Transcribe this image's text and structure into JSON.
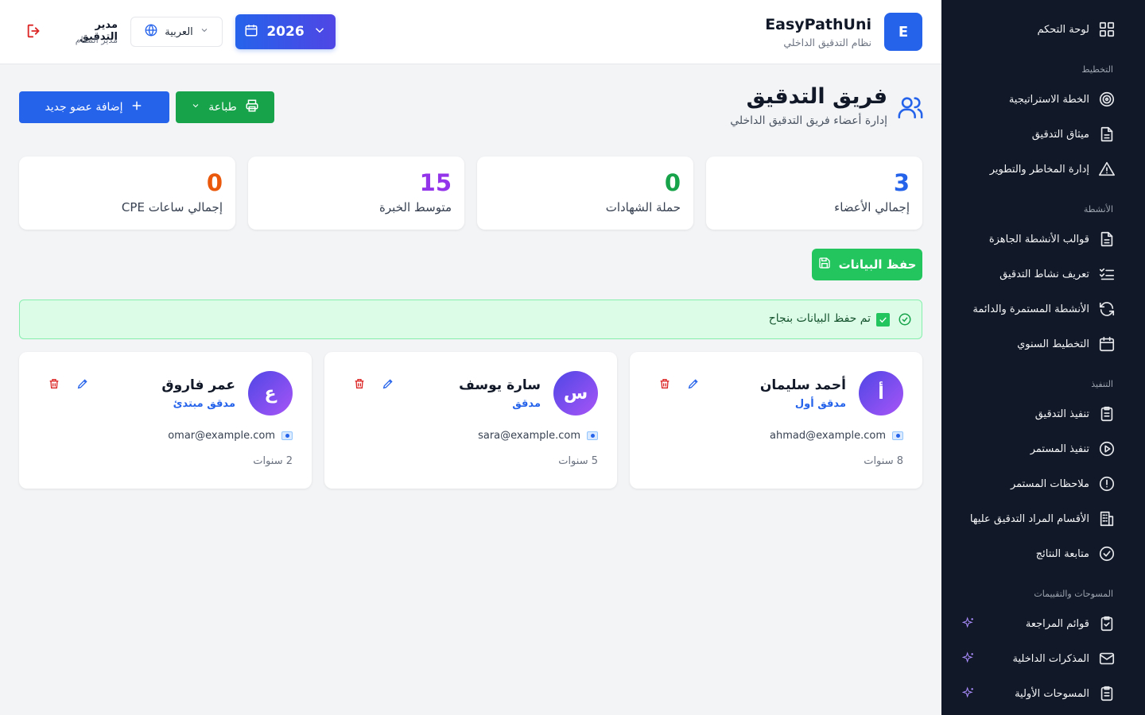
{
  "header": {
    "brand_logo": "E",
    "brand_name": "EasyPathUni",
    "brand_sub": "نظام التدقيق الداخلي",
    "year": "2026",
    "language": "العربية",
    "user_name": "مدير التدقيق",
    "user_role": "مدير النظام"
  },
  "sidebar": {
    "dashboard": "لوحة التحكم",
    "sections": {
      "planning": "التخطيط",
      "activities": "الأنشطة",
      "execution": "التنفيذ",
      "surveys": "المسوحات والتقييمات"
    },
    "items": [
      {
        "label": "الخطة الاستراتيجية",
        "icon": "target-icon"
      },
      {
        "label": "ميثاق التدقيق",
        "icon": "document-icon"
      },
      {
        "label": "إدارة المخاطر والتطوير",
        "icon": "warning-icon"
      },
      {
        "label": "قوالب الأنشطة الجاهزة",
        "icon": "document-icon"
      },
      {
        "label": "تعريف نشاط التدقيق",
        "icon": "checklist-icon"
      },
      {
        "label": "الأنشطة المستمرة والدائمة",
        "icon": "refresh-icon"
      },
      {
        "label": "التخطيط السنوي",
        "icon": "calendar-icon"
      },
      {
        "label": "تنفيذ التدقيق",
        "icon": "clipboard-list-icon"
      },
      {
        "label": "تنفيذ المستمر",
        "icon": "play-circle-icon"
      },
      {
        "label": "ملاحظات المستمر",
        "icon": "alert-circle-icon"
      },
      {
        "label": "الأقسام المراد التدقيق عليها",
        "icon": "building-icon"
      },
      {
        "label": "متابعة النتائج",
        "icon": "check-circle-icon"
      },
      {
        "label": "قوائم المراجعة",
        "icon": "clipboard-check-icon"
      },
      {
        "label": "المذكرات الداخلية",
        "icon": "mail-icon"
      },
      {
        "label": "المسوحات الأولية",
        "icon": "clipboard-list-icon"
      }
    ]
  },
  "page": {
    "title": "فريق التدقيق",
    "subtitle": "إدارة أعضاء فريق التدقيق الداخلي",
    "add_label": "إضافة عضو جديد",
    "print_label": "طباعة",
    "save_label": "حفظ البيانات",
    "alert_text": "تم حفظ البيانات بنجاح"
  },
  "stats": [
    {
      "label": "إجمالي الأعضاء",
      "value": "3",
      "color": "#2563eb"
    },
    {
      "label": "حملة الشهادات",
      "value": "0",
      "color": "#16a34a"
    },
    {
      "label": "متوسط الخبرة",
      "value": "15",
      "color": "#9333ea"
    },
    {
      "label": "إجمالي ساعات CPE",
      "value": "0",
      "color": "#ea580c"
    }
  ],
  "members": [
    {
      "initial": "أ",
      "name": "أحمد سليمان",
      "role": "مدقق أول",
      "email": "ahmad@example.com",
      "experience": "8 سنوات"
    },
    {
      "initial": "س",
      "name": "سارة يوسف",
      "role": "مدقق",
      "email": "sara@example.com",
      "experience": "5 سنوات"
    },
    {
      "initial": "ع",
      "name": "عمر فاروق",
      "role": "مدقق مبتدئ",
      "email": "omar@example.com",
      "experience": "2 سنوات"
    }
  ]
}
